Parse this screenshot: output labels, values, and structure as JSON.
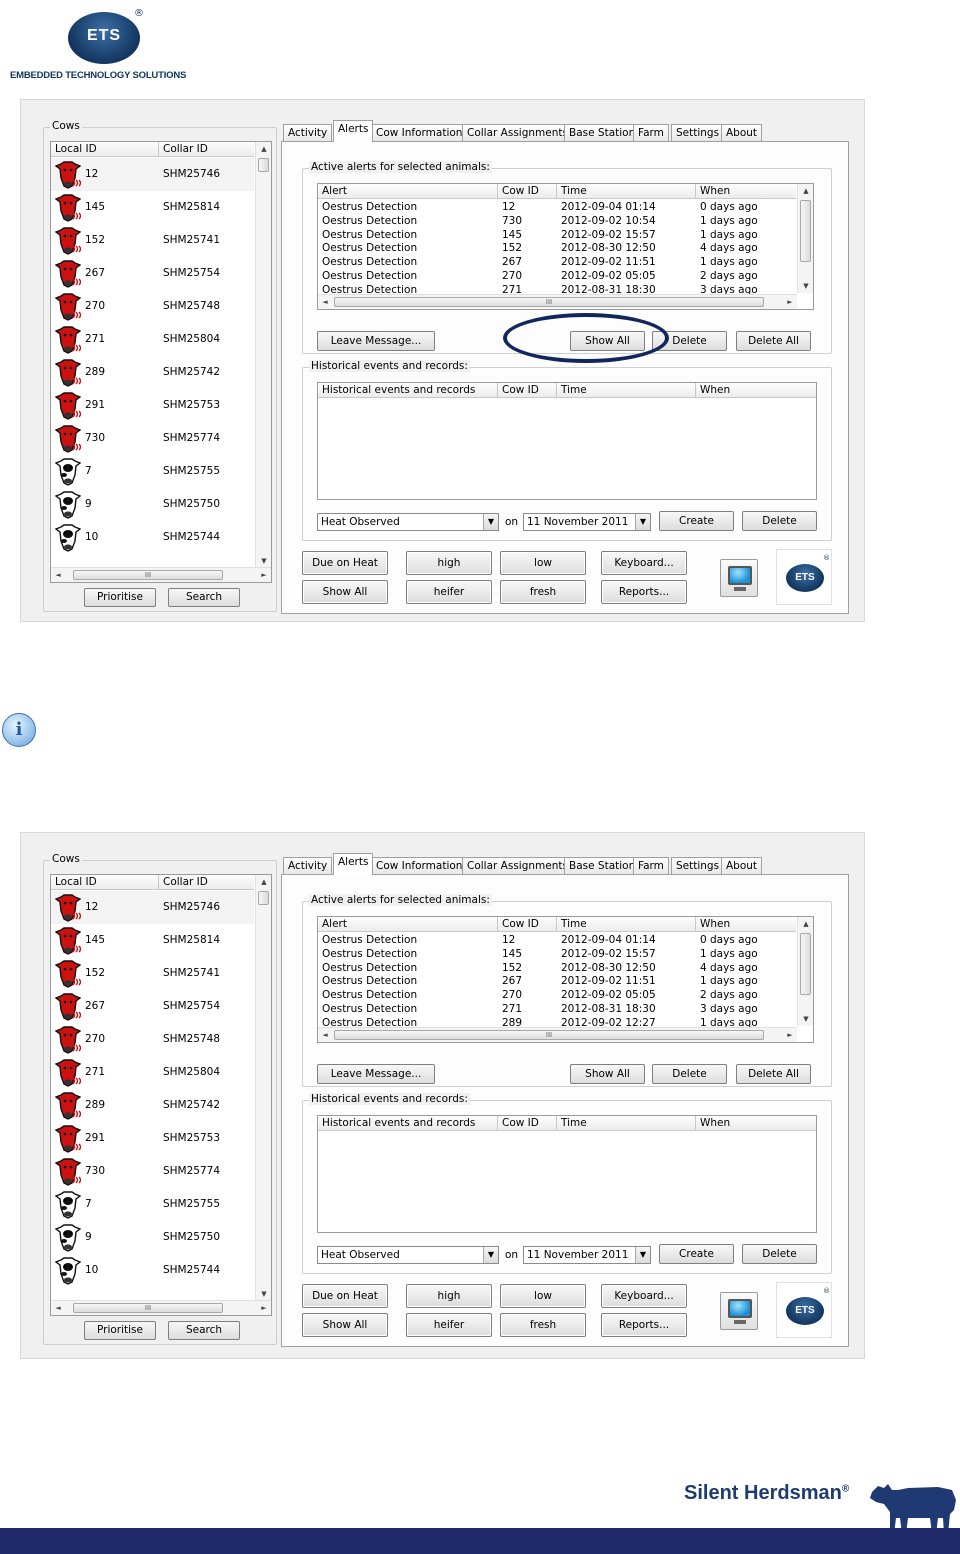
{
  "logo": {
    "name": "ETS",
    "registered": "®",
    "tagline": "EMBEDDED TECHNOLOGY SOLUTIONS"
  },
  "screens": [
    {
      "cows": {
        "legend": "Cows",
        "headers": [
          "Local ID",
          "Collar ID"
        ],
        "rows": [
          {
            "local_id": "12",
            "collar_id": "SHM25746",
            "icon": "cow-in-heat-icon"
          },
          {
            "local_id": "145",
            "collar_id": "SHM25814",
            "icon": "cow-in-heat-icon"
          },
          {
            "local_id": "152",
            "collar_id": "SHM25741",
            "icon": "cow-in-heat-icon"
          },
          {
            "local_id": "267",
            "collar_id": "SHM25754",
            "icon": "cow-in-heat-icon"
          },
          {
            "local_id": "270",
            "collar_id": "SHM25748",
            "icon": "cow-in-heat-icon"
          },
          {
            "local_id": "271",
            "collar_id": "SHM25804",
            "icon": "cow-in-heat-icon"
          },
          {
            "local_id": "289",
            "collar_id": "SHM25742",
            "icon": "cow-in-heat-icon"
          },
          {
            "local_id": "291",
            "collar_id": "SHM25753",
            "icon": "cow-in-heat-icon"
          },
          {
            "local_id": "730",
            "collar_id": "SHM25774",
            "icon": "cow-in-heat-icon"
          },
          {
            "local_id": "7",
            "collar_id": "SHM25755",
            "icon": "cow-normal-icon"
          },
          {
            "local_id": "9",
            "collar_id": "SHM25750",
            "icon": "cow-normal-icon"
          },
          {
            "local_id": "10",
            "collar_id": "SHM25744",
            "icon": "cow-normal-icon"
          }
        ],
        "prioritise": "Prioritise",
        "search": "Search"
      },
      "tabs": [
        "Activity",
        "Alerts",
        "Cow Information",
        "Collar Assignments",
        "Base Station",
        "Farm",
        "Settings",
        "About"
      ],
      "active_tab": "Alerts",
      "alerts": {
        "legend": "Active alerts for selected animals:",
        "headers": [
          "Alert",
          "Cow ID",
          "Time",
          "When"
        ],
        "rows": [
          {
            "alert": "Oestrus Detection",
            "cow_id": "12",
            "time": "2012-09-04 01:14",
            "when": "0 days ago"
          },
          {
            "alert": "Oestrus Detection",
            "cow_id": "730",
            "time": "2012-09-02 10:54",
            "when": "1 days ago"
          },
          {
            "alert": "Oestrus Detection",
            "cow_id": "145",
            "time": "2012-09-02 15:57",
            "when": "1 days ago"
          },
          {
            "alert": "Oestrus Detection",
            "cow_id": "152",
            "time": "2012-08-30 12:50",
            "when": "4 days ago"
          },
          {
            "alert": "Oestrus Detection",
            "cow_id": "267",
            "time": "2012-09-02 11:51",
            "when": "1 days ago"
          },
          {
            "alert": "Oestrus Detection",
            "cow_id": "270",
            "time": "2012-09-02 05:05",
            "when": "2 days ago"
          },
          {
            "alert": "Oestrus Detection",
            "cow_id": "271",
            "time": "2012-08-31 18:30",
            "when": "3 days ago"
          }
        ],
        "leave_message": "Leave Message...",
        "show_all": "Show All",
        "delete": "Delete",
        "delete_all": "Delete All"
      },
      "history": {
        "legend": "Historical events and records:",
        "headers": [
          "Historical events and records",
          "Cow ID",
          "Time",
          "When"
        ],
        "event_type": "Heat Observed",
        "on_label": "on",
        "date": "11 November  2011",
        "create": "Create",
        "delete": "Delete"
      },
      "bottom": {
        "due_on_heat": "Due on Heat",
        "show_all": "Show All",
        "high": "high",
        "heifer": "heifer",
        "low": "low",
        "fresh": "fresh",
        "keyboard": "Keyboard...",
        "reports": "Reports..."
      }
    },
    {
      "cows": {
        "legend": "Cows",
        "headers": [
          "Local ID",
          "Collar ID"
        ],
        "rows": [
          {
            "local_id": "12",
            "collar_id": "SHM25746",
            "icon": "cow-in-heat-icon"
          },
          {
            "local_id": "145",
            "collar_id": "SHM25814",
            "icon": "cow-in-heat-icon"
          },
          {
            "local_id": "152",
            "collar_id": "SHM25741",
            "icon": "cow-in-heat-icon"
          },
          {
            "local_id": "267",
            "collar_id": "SHM25754",
            "icon": "cow-in-heat-icon"
          },
          {
            "local_id": "270",
            "collar_id": "SHM25748",
            "icon": "cow-in-heat-icon"
          },
          {
            "local_id": "271",
            "collar_id": "SHM25804",
            "icon": "cow-in-heat-icon"
          },
          {
            "local_id": "289",
            "collar_id": "SHM25742",
            "icon": "cow-in-heat-icon"
          },
          {
            "local_id": "291",
            "collar_id": "SHM25753",
            "icon": "cow-in-heat-icon"
          },
          {
            "local_id": "730",
            "collar_id": "SHM25774",
            "icon": "cow-in-heat-icon"
          },
          {
            "local_id": "7",
            "collar_id": "SHM25755",
            "icon": "cow-normal-icon"
          },
          {
            "local_id": "9",
            "collar_id": "SHM25750",
            "icon": "cow-normal-icon"
          },
          {
            "local_id": "10",
            "collar_id": "SHM25744",
            "icon": "cow-normal-icon"
          }
        ],
        "prioritise": "Prioritise",
        "search": "Search"
      },
      "tabs": [
        "Activity",
        "Alerts",
        "Cow Information",
        "Collar Assignments",
        "Base Station",
        "Farm",
        "Settings",
        "About"
      ],
      "active_tab": "Alerts",
      "alerts": {
        "legend": "Active alerts for selected animals:",
        "headers": [
          "Alert",
          "Cow ID",
          "Time",
          "When"
        ],
        "rows": [
          {
            "alert": "Oestrus Detection",
            "cow_id": "12",
            "time": "2012-09-04 01:14",
            "when": "0 days ago"
          },
          {
            "alert": "Oestrus Detection",
            "cow_id": "145",
            "time": "2012-09-02 15:57",
            "when": "1 days ago"
          },
          {
            "alert": "Oestrus Detection",
            "cow_id": "152",
            "time": "2012-08-30 12:50",
            "when": "4 days ago"
          },
          {
            "alert": "Oestrus Detection",
            "cow_id": "267",
            "time": "2012-09-02 11:51",
            "when": "1 days ago"
          },
          {
            "alert": "Oestrus Detection",
            "cow_id": "270",
            "time": "2012-09-02 05:05",
            "when": "2 days ago"
          },
          {
            "alert": "Oestrus Detection",
            "cow_id": "271",
            "time": "2012-08-31 18:30",
            "when": "3 days ago"
          },
          {
            "alert": "Oestrus Detection",
            "cow_id": "289",
            "time": "2012-09-02 12:27",
            "when": "1 days ago"
          }
        ],
        "leave_message": "Leave Message...",
        "show_all": "Show All",
        "delete": "Delete",
        "delete_all": "Delete All"
      },
      "history": {
        "legend": "Historical events and records:",
        "headers": [
          "Historical events and records",
          "Cow ID",
          "Time",
          "When"
        ],
        "event_type": "Heat Observed",
        "on_label": "on",
        "date": "11 November  2011",
        "create": "Create",
        "delete": "Delete"
      },
      "bottom": {
        "due_on_heat": "Due on Heat",
        "show_all": "Show All",
        "high": "high",
        "heifer": "heifer",
        "low": "low",
        "fresh": "fresh",
        "keyboard": "Keyboard...",
        "reports": "Reports..."
      }
    }
  ],
  "scroll_glyph": "III",
  "info_icon": "i",
  "footer": {
    "brand": "Silent Herdsman",
    "registered": "®"
  },
  "colors": {
    "brand_navy": "#12365f",
    "footer_bar": "#1f2a6b",
    "highlight_ring": "#12265e",
    "cow_red": "#cc1111"
  }
}
